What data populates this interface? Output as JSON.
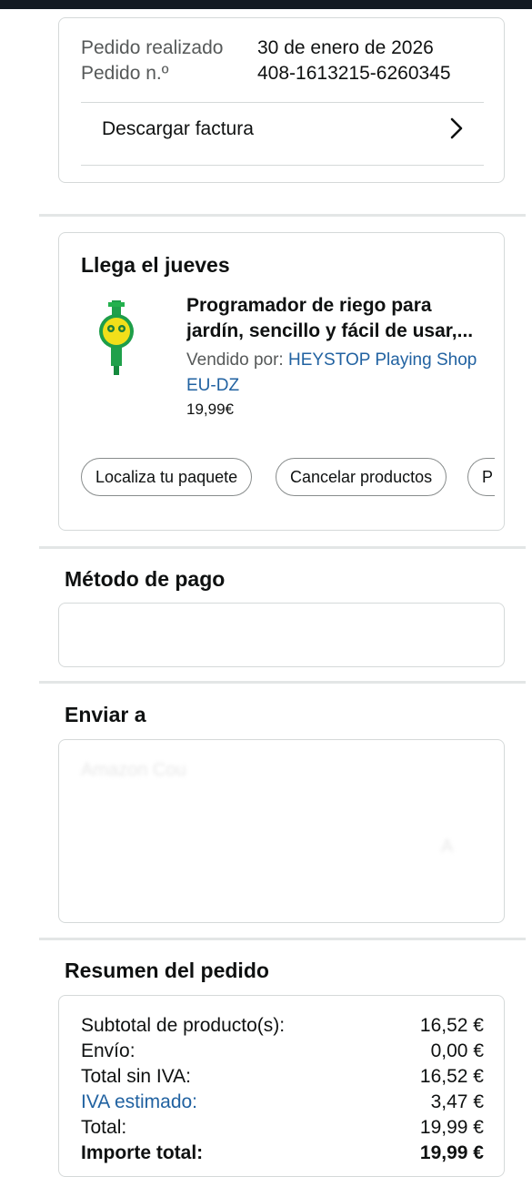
{
  "order": {
    "placed_label": "Pedido realizado",
    "placed_value": "30 de enero de 2026",
    "number_label": "Pedido n.º",
    "number_value": "408-1613215-6260345",
    "invoice_label": "Descargar factura"
  },
  "delivery": {
    "arrival": "Llega el jueves",
    "product_title_line1": "Programador de riego para",
    "product_title_line2": "jardín, sencillo y fácil de usar,...",
    "seller_prefix": "Vendido por: ",
    "seller_name": "HEYSTOP Playing Shop EU-DZ",
    "price": "19,99€",
    "actions": [
      "Localiza tu paquete",
      "Cancelar productos",
      "P"
    ]
  },
  "payment": {
    "title": "Método de pago"
  },
  "shipping": {
    "title": "Enviar a",
    "partial_text_1": "Amazon Cou",
    "partial_text_2": "A"
  },
  "summary": {
    "title": "Resumen del pedido",
    "rows": [
      {
        "label": "Subtotal de producto(s):",
        "value": "16,52 €"
      },
      {
        "label": "Envío:",
        "value": "0,00 €"
      },
      {
        "label": "Total sin IVA:",
        "value": "16,52 €"
      },
      {
        "label": "IVA estimado:",
        "value": "3,47 €"
      },
      {
        "label": "Total:",
        "value": "19,99 €"
      },
      {
        "label": "Importe total:",
        "value": "19,99 €"
      }
    ]
  },
  "colors": {
    "link": "#2162a1",
    "border": "#d5d9d9",
    "text": "#0f1111",
    "muted": "#565959"
  }
}
